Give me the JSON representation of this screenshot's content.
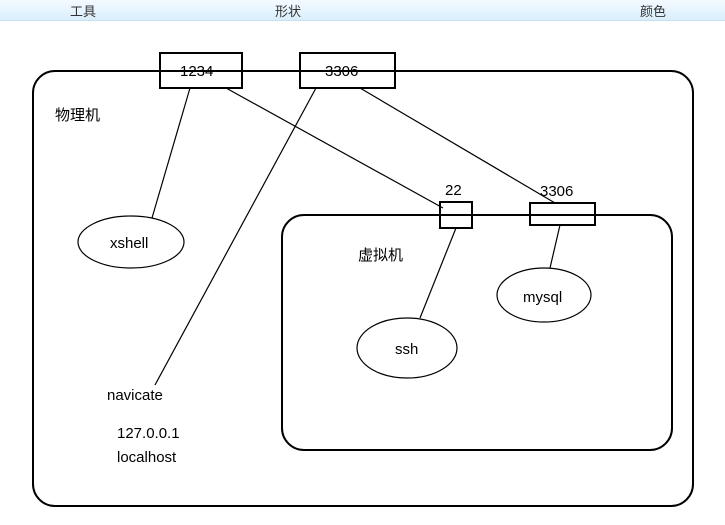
{
  "toolbar": {
    "tool": "工具",
    "shape": "形状",
    "color": "颜色"
  },
  "diagram": {
    "outer_label": "物理机",
    "inner_label": "虚拟机",
    "port_outer_left": "1234",
    "port_outer_right": "3306",
    "port_inner_left": "22",
    "port_inner_right_label": "3306",
    "node_xshell": "xshell",
    "node_ssh": "ssh",
    "node_mysql": "mysql",
    "text_navicate": "navicate",
    "text_ip": "127.0.0.1",
    "text_localhost": "localhost"
  }
}
